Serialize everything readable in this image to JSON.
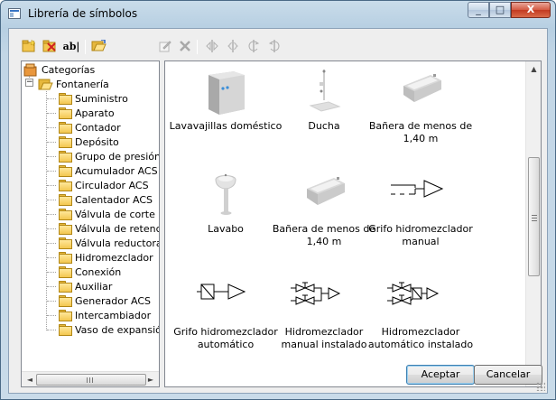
{
  "window": {
    "title": "Librería de símbolos",
    "controls": {
      "minimize": "_",
      "maximize": "□",
      "close": "X"
    }
  },
  "toolbar": {
    "buttons": [
      {
        "name": "new-folder-icon",
        "enabled": true
      },
      {
        "name": "delete-folder-icon",
        "enabled": true
      },
      {
        "name": "rename-icon",
        "label": "ab|",
        "enabled": true
      },
      {
        "name": "open-folder-icon",
        "enabled": true
      },
      {
        "name": "edit-symbol-icon",
        "enabled": false
      },
      {
        "name": "delete-symbol-icon",
        "enabled": false
      },
      {
        "name": "flip-horizontal-icon",
        "enabled": false
      },
      {
        "name": "flip-vertical-icon",
        "enabled": false
      },
      {
        "name": "rotate-left-icon",
        "enabled": false
      },
      {
        "name": "rotate-right-icon",
        "enabled": false
      }
    ]
  },
  "tree": {
    "root": "Categorías",
    "category": "Fontanería",
    "children": [
      "Suministro",
      "Aparato",
      "Contador",
      "Depósito",
      "Grupo de presión",
      "Acumulador ACS",
      "Circulador ACS",
      "Calentador ACS",
      "Válvula de corte",
      "Válvula de retenc",
      "Válvula reductora",
      "Hidromezclador",
      "Conexión",
      "Auxiliar",
      "Generador ACS",
      "Intercambiador",
      "Vaso de expansió"
    ]
  },
  "symbols": [
    {
      "line1": "Lavavajillas doméstico",
      "line2": "",
      "icon": "dishwasher-icon"
    },
    {
      "line1": "Ducha",
      "line2": "",
      "icon": "shower-icon"
    },
    {
      "line1": "Bañera de menos de",
      "line2": "1,40 m",
      "icon": "bathtub-icon"
    },
    {
      "line1": "Lavabo",
      "line2": "",
      "icon": "washbasin-icon"
    },
    {
      "line1": "Bañera de menos de",
      "line2": "1,40 m",
      "icon": "bathtub-icon"
    },
    {
      "line1": "Grifo hidromezclador",
      "line2": "manual",
      "icon": "manual-mixer-symbol-icon"
    },
    {
      "line1": "Grifo hidromezclador",
      "line2": "automático",
      "icon": "automatic-mixer-symbol-icon"
    },
    {
      "line1": "Hidromezclador",
      "line2": "manual instalado",
      "icon": "installed-manual-mixer-symbol-icon"
    },
    {
      "line1": "Hidromezclador",
      "line2": "automático instalado",
      "icon": "installed-automatic-mixer-symbol-icon"
    }
  ],
  "buttons": {
    "accept": "Aceptar",
    "cancel": "Cancelar"
  },
  "scroll": {
    "vertical_position": 0.3,
    "horizontal_position": 0.0
  },
  "colors": {
    "folder": "#f3c750",
    "accent": "#3c7fb1",
    "close_button": "#c23a20"
  }
}
